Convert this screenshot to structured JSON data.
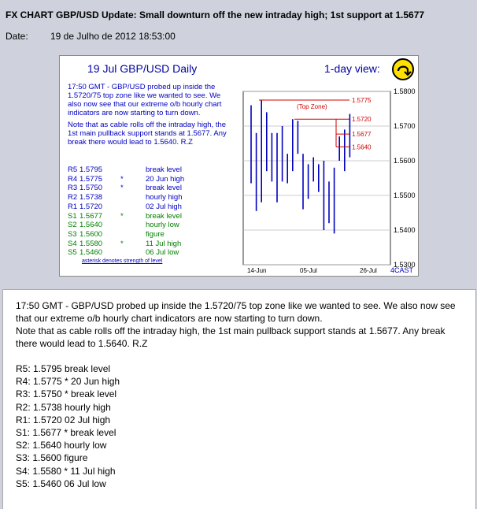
{
  "header": {
    "title": "FX CHART GBP/USD Update: Small downturn off the new intraday high; 1st support at 1.5677",
    "date_label": "Date:",
    "date_value": "19 de Julho de 2012 18:53:00"
  },
  "chart": {
    "title": "19 Jul   GBP/USD  Daily",
    "view_label": "1-day view:",
    "logo_name": "4cast-logo-icon",
    "brand": "4CAST",
    "commentary": [
      "17:50 GMT - GBP/USD probed up inside the 1.5720/75 top zone like we wanted to see. We also now see that our extreme o/b hourly chart indicators are now starting to turn down.",
      "Note that as cable rolls off the intraday high, the 1st main pullback support stands at 1.5677. Any break there would lead to 1.5640.  R.Z"
    ],
    "levels": [
      {
        "code": "R5",
        "value": "1.5795",
        "star": "",
        "desc": "break level",
        "kind": "res"
      },
      {
        "code": "R4",
        "value": "1.5775",
        "star": "*",
        "desc": "20 Jun high",
        "kind": "res"
      },
      {
        "code": "R3",
        "value": "1.5750",
        "star": "*",
        "desc": "break level",
        "kind": "res"
      },
      {
        "code": "R2",
        "value": "1.5738",
        "star": "",
        "desc": "hourly high",
        "kind": "res"
      },
      {
        "code": "R1",
        "value": "1.5720",
        "star": "",
        "desc": "02 Jul high",
        "kind": "res"
      },
      {
        "code": "S1",
        "value": "1.5677",
        "star": "*",
        "desc": "break level",
        "kind": "sup"
      },
      {
        "code": "S2",
        "value": "1.5640",
        "star": "",
        "desc": "hourly low",
        "kind": "sup"
      },
      {
        "code": "S3",
        "value": "1.5600",
        "star": "",
        "desc": "figure",
        "kind": "sup"
      },
      {
        "code": "S4",
        "value": "1.5580",
        "star": "*",
        "desc": "11 Jul high",
        "kind": "sup"
      },
      {
        "code": "S5",
        "value": "1.5460",
        "star": "",
        "desc": "06 Jul low",
        "kind": "sup"
      }
    ],
    "asterisk_note": "asterisk denotes strength of level",
    "top_zone_label": "(Top Zone)"
  },
  "chart_data": {
    "type": "bar",
    "ylim": [
      1.53,
      1.58
    ],
    "yticks": [
      "1.5800",
      "1.5700",
      "1.5600",
      "1.5500",
      "1.5400",
      "1.5300"
    ],
    "xticks": [
      "14-Jun",
      "05-Jul",
      "26-Jul"
    ],
    "ohlc": [
      {
        "low": 1.5535,
        "high": 1.576
      },
      {
        "low": 1.5455,
        "high": 1.568
      },
      {
        "low": 1.548,
        "high": 1.5775
      },
      {
        "low": 1.557,
        "high": 1.574
      },
      {
        "low": 1.554,
        "high": 1.568
      },
      {
        "low": 1.548,
        "high": 1.568
      },
      {
        "low": 1.554,
        "high": 1.57
      },
      {
        "low": 1.5535,
        "high": 1.562
      },
      {
        "low": 1.557,
        "high": 1.572
      },
      {
        "low": 1.562,
        "high": 1.5715
      },
      {
        "low": 1.546,
        "high": 1.562
      },
      {
        "low": 1.549,
        "high": 1.559
      },
      {
        "low": 1.554,
        "high": 1.561
      },
      {
        "low": 1.551,
        "high": 1.559
      },
      {
        "low": 1.54,
        "high": 1.56
      },
      {
        "low": 1.542,
        "high": 1.554
      },
      {
        "low": 1.539,
        "high": 1.558
      },
      {
        "low": 1.56,
        "high": 1.567
      },
      {
        "low": 1.557,
        "high": 1.569
      },
      {
        "low": 1.561,
        "high": 1.5735
      }
    ],
    "hlines": [
      {
        "value": 1.5775,
        "label": "1.5775"
      },
      {
        "value": 1.572,
        "label": "1.5720"
      },
      {
        "value": 1.5677,
        "label": "1.5677"
      },
      {
        "value": 1.564,
        "label": "1.5640"
      }
    ],
    "line_color": "#0000c0",
    "level_color": "#d00000"
  },
  "body": {
    "paragraphs": [
      "17:50 GMT - GBP/USD probed up inside the 1.5720/75 top zone like we   wanted to see. We also now see that our extreme o/b hourly chart     indicators are now starting to turn down.",
      "Note that as cable rolls off the intraday high, the 1st main pullback support stands at 1.5677. Any break there would lead to 1.5640.  R.Z"
    ],
    "levels": [
      "R5: 1.5795  break level",
      "R4: 1.5775 * 20 Jun high",
      "R3: 1.5750 * break level",
      "R2: 1.5738  hourly high",
      "R1: 1.5720  02 Jul high",
      "S1: 1.5677 * break level",
      "S2: 1.5640  hourly low",
      "S3: 1.5600  figure",
      "S4: 1.5580 * 11 Jul high",
      "S5: 1.5460  06 Jul low"
    ]
  }
}
